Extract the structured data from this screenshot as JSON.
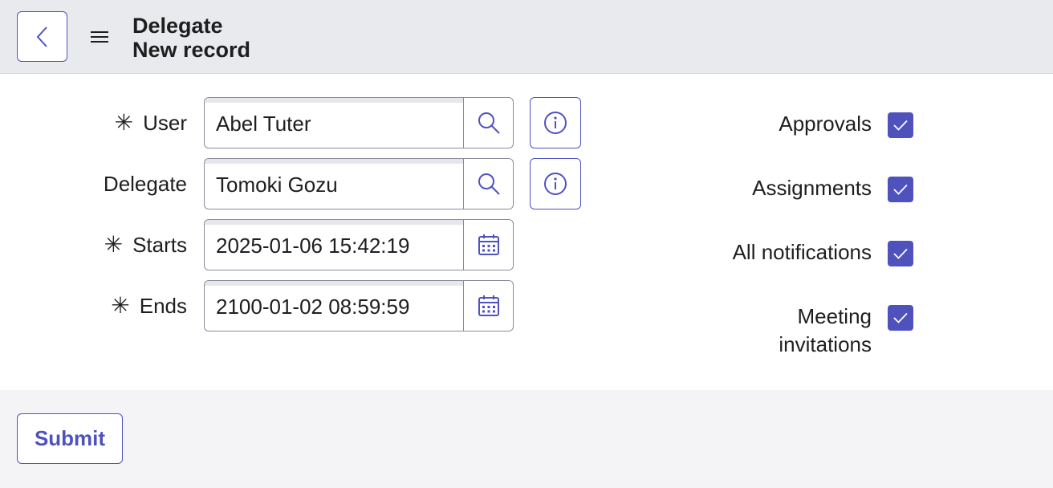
{
  "header": {
    "title": "Delegate",
    "subtitle": "New record"
  },
  "form": {
    "user": {
      "label": "User",
      "value": "Abel Tuter",
      "required": true
    },
    "delegate": {
      "label": "Delegate",
      "value": "Tomoki Gozu",
      "required": false
    },
    "starts": {
      "label": "Starts",
      "value": "2025-01-06 15:42:19",
      "required": true
    },
    "ends": {
      "label": "Ends",
      "value": "2100-01-02 08:59:59",
      "required": true
    },
    "required_marker": "✳"
  },
  "options": {
    "approvals": {
      "label": "Approvals",
      "checked": true
    },
    "assignments": {
      "label": "Assignments",
      "checked": true
    },
    "all_notifications": {
      "label": "All notifications",
      "checked": true
    },
    "meeting_invitations": {
      "label_line1": "Meeting",
      "label_line2": "invitations",
      "checked": true
    }
  },
  "footer": {
    "submit_label": "Submit"
  },
  "colors": {
    "accent": "#4f52bd",
    "header_bg": "#e9eaee",
    "footer_bg": "#f4f4f7"
  },
  "icons": [
    "chevron-left-icon",
    "hamburger-menu-icon",
    "search-icon",
    "info-icon",
    "calendar-icon",
    "checkmark-icon"
  ]
}
